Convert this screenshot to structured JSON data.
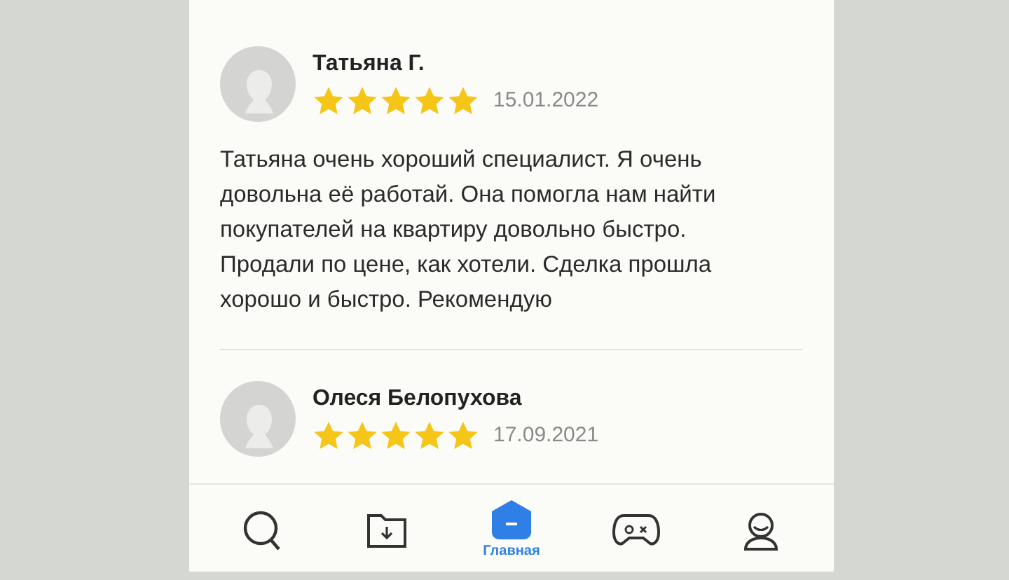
{
  "reviews": [
    {
      "author": "Татьяна Г.",
      "stars": 5,
      "date": "15.01.2022",
      "text": "Татьяна очень хороший специалист. Я очень довольна её работай. Она помогла нам найти покупателей на квартиру довольно быстро. Продали по цене, как хотели. Сделка прошла хорошо и быстро. Рекомендую"
    },
    {
      "author": "Олеся Белопухова",
      "stars": 5,
      "date": "17.09.2021"
    }
  ],
  "nav": [
    {
      "kind": "search",
      "selected": false
    },
    {
      "kind": "downloads",
      "selected": false
    },
    {
      "kind": "home",
      "selected": true,
      "label": "Главная"
    },
    {
      "kind": "games",
      "selected": false
    },
    {
      "kind": "profile",
      "selected": false
    }
  ]
}
